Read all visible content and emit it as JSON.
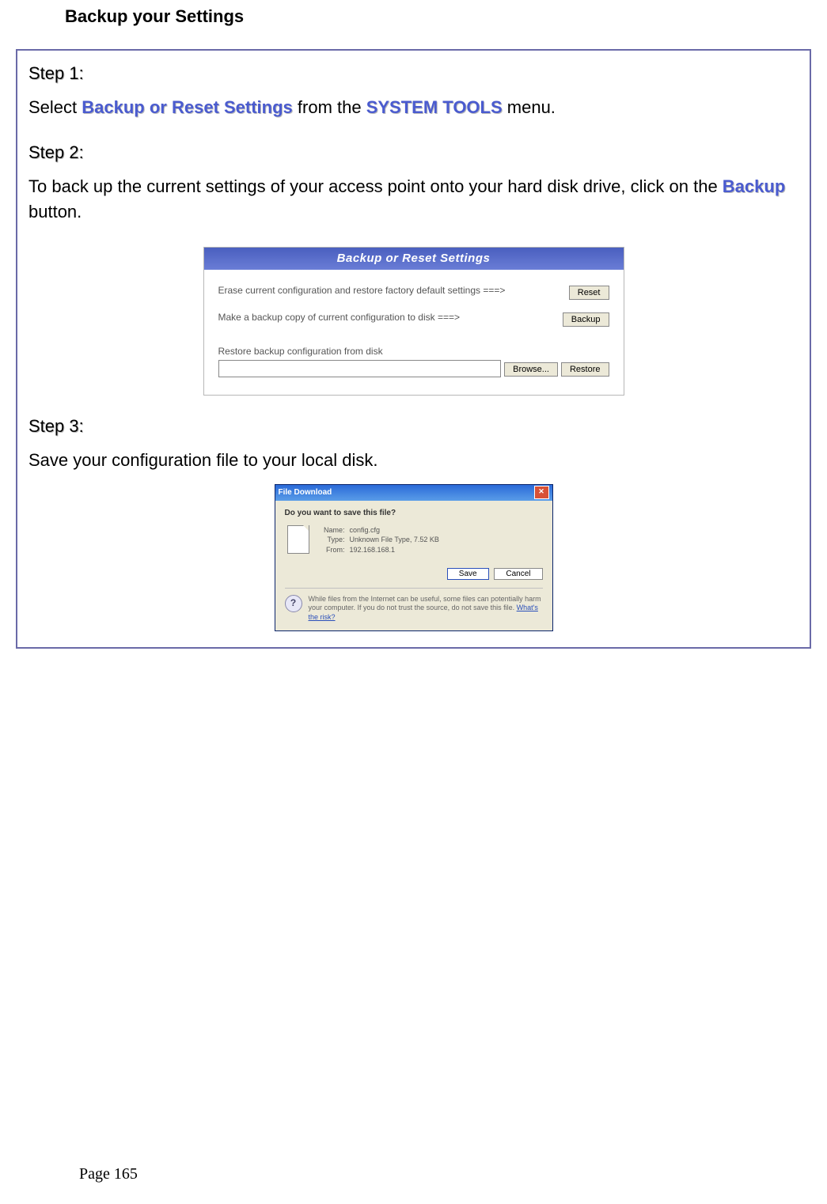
{
  "title": "Backup your Settings",
  "steps": {
    "s1": {
      "label": "Step 1:",
      "pre": "Select ",
      "link1": "Backup or Reset Settings",
      "mid": " from the ",
      "link2": "SYSTEM TOOLS",
      "post": " menu."
    },
    "s2": {
      "label": "Step 2:",
      "pre": "To back up the current settings of your access point onto your hard disk drive, click on the ",
      "link1": "Backup",
      "post": " button."
    },
    "s3": {
      "label": "Step 3:",
      "text": "Save your configuration file to your local disk."
    }
  },
  "ui1": {
    "title": "Backup or Reset Settings",
    "row1_text": "Erase current configuration and restore factory default settings ===>",
    "row1_btn": "Reset",
    "row2_text": "Make a backup copy of current configuration to disk ===>",
    "row2_btn": "Backup",
    "restore_label": "Restore backup configuration from disk",
    "file_value": "",
    "browse_btn": "Browse...",
    "restore_btn": "Restore"
  },
  "ui2": {
    "title": "File Download",
    "question": "Do you want to save this file?",
    "meta": {
      "name_k": "Name:",
      "name_v": "config.cfg",
      "type_k": "Type:",
      "type_v": "Unknown File Type, 7.52 KB",
      "from_k": "From:",
      "from_v": "192.168.168.1"
    },
    "save_btn": "Save",
    "cancel_btn": "Cancel",
    "warn_text": "While files from the Internet can be useful, some files can potentially harm your computer. If you do not trust the source, do not save this file. ",
    "warn_link": "What's the risk?"
  },
  "footer": "Page 165"
}
